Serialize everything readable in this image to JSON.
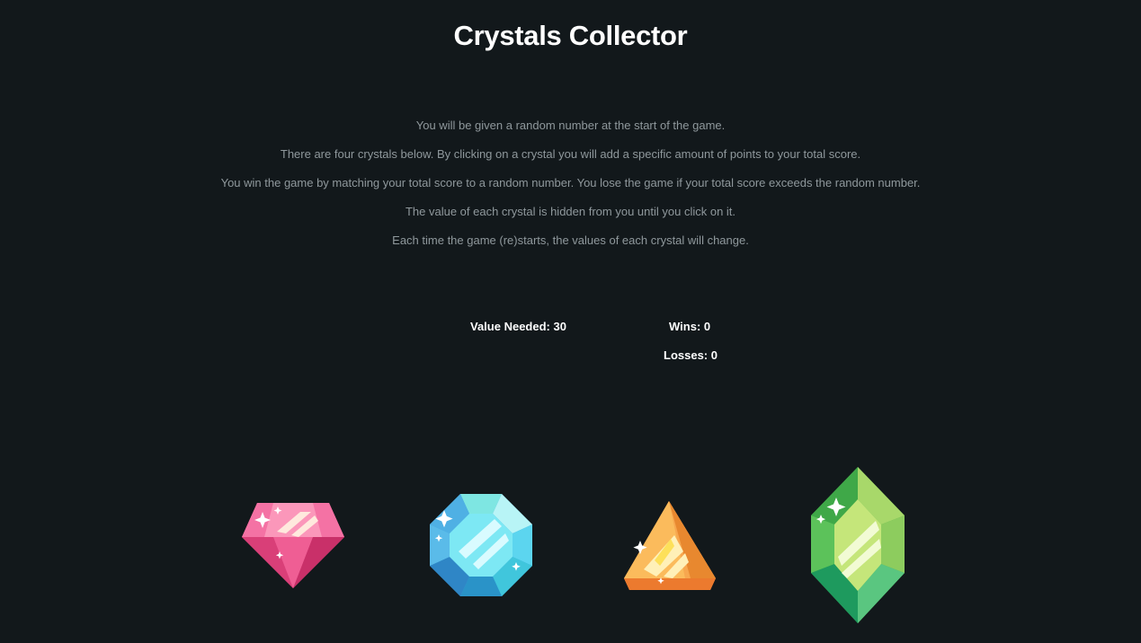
{
  "page": {
    "title": "Crystals Collector"
  },
  "instructions": [
    "You will be given a random number at the start of the game.",
    "There are four crystals below. By clicking on a crystal you will add a specific amount of points to your total score.",
    "You win the game by matching your total score to a random number. You lose the game if your total score exceeds the random number.",
    "The value of each crystal is hidden from you until you click on it.",
    "Each time the game (re)starts, the values of each crystal will change."
  ],
  "stats": {
    "value_needed_label": "Value Needed:",
    "value_needed": "30",
    "wins_label": "Wins:",
    "wins": "0",
    "losses_label": "Losses:",
    "losses": "0"
  },
  "crystals": [
    {
      "icon": "pink-diamond-crystal-icon",
      "color": "#f06b98"
    },
    {
      "icon": "blue-octagon-crystal-icon",
      "color": "#5dd6ee"
    },
    {
      "icon": "orange-triangle-crystal-icon",
      "color": "#f5a04a"
    },
    {
      "icon": "green-hexagon-crystal-icon",
      "color": "#5cc25a"
    }
  ],
  "colors": {
    "background": "#12181b",
    "title": "#ffffff",
    "instructions_text": "#8f989c",
    "stats_text": "#ffffff"
  }
}
